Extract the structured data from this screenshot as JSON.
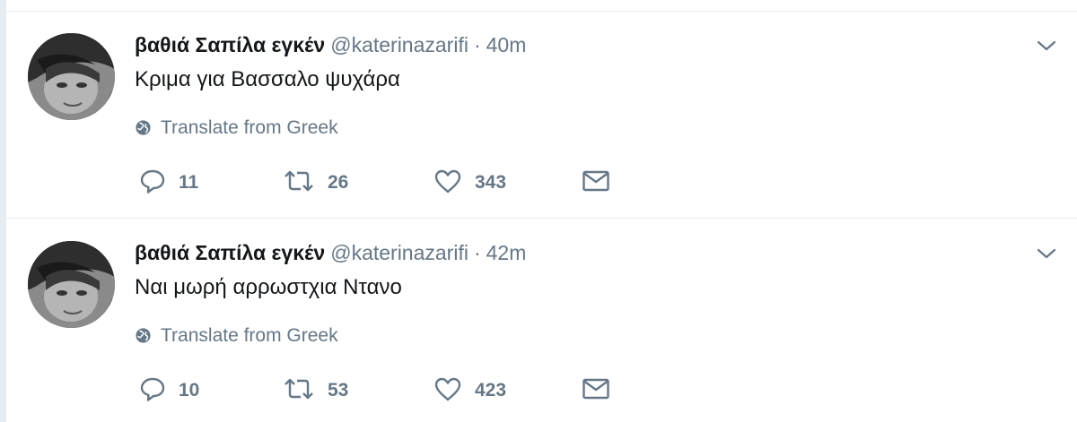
{
  "tweets": [
    {
      "fullname": "βαθιά Σαπίλα εγκέν",
      "username": "@katerinazarifi",
      "separator": "·",
      "time": "40m",
      "text": "Κριμα για Βασσαλο ψυχάρα",
      "translate_label": "Translate from Greek",
      "reply_count": "11",
      "retweet_count": "26",
      "like_count": "343"
    },
    {
      "fullname": "βαθιά Σαπίλα εγκέν",
      "username": "@katerinazarifi",
      "separator": "·",
      "time": "42m",
      "text": "Ναι μωρή αρρωστχια Ντανο",
      "translate_label": "Translate from Greek",
      "reply_count": "10",
      "retweet_count": "53",
      "like_count": "423"
    }
  ],
  "icons": {
    "reply": "reply-icon",
    "retweet": "retweet-icon",
    "like": "heart-icon",
    "direct_message": "envelope-icon",
    "translate": "globe-icon",
    "more": "chevron-down-icon"
  },
  "colors": {
    "name": "#14171a",
    "secondary": "#657786",
    "divider": "#e6ecf0"
  }
}
